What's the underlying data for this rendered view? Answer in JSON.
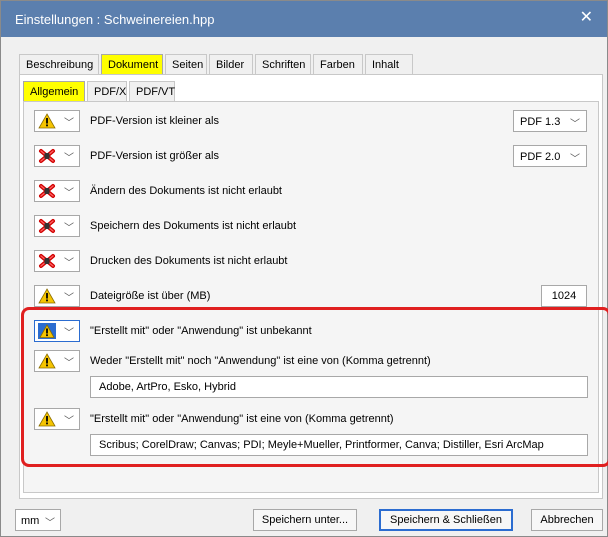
{
  "window": {
    "title": "Einstellungen : Schweinereien.hpp",
    "close_glyph": "✕"
  },
  "tabs": [
    {
      "label": "Beschreibung",
      "active": false
    },
    {
      "label": "Dokument",
      "active": true
    },
    {
      "label": "Seiten",
      "active": false
    },
    {
      "label": "Bilder",
      "active": false
    },
    {
      "label": "Schriften",
      "active": false
    },
    {
      "label": "Farben",
      "active": false
    },
    {
      "label": "Inhalt",
      "active": false
    }
  ],
  "subtabs": [
    {
      "label": "Allgemein",
      "active": true
    },
    {
      "label": "PDF/X",
      "active": false
    },
    {
      "label": "PDF/VT",
      "active": false
    }
  ],
  "rules": {
    "r1": {
      "severity": "warning-icon",
      "label": "PDF-Version ist kleiner als",
      "select": "PDF 1.3"
    },
    "r2": {
      "severity": "error-icon",
      "label": "PDF-Version ist größer als",
      "select": "PDF 2.0"
    },
    "r3": {
      "severity": "error-icon",
      "label": "Ändern des Dokuments ist nicht erlaubt"
    },
    "r4": {
      "severity": "error-icon",
      "label": "Speichern des Dokuments ist nicht erlaubt"
    },
    "r5": {
      "severity": "error-icon",
      "label": "Drucken des Dokuments ist nicht erlaubt"
    },
    "r6": {
      "severity": "warning-icon",
      "label": "Dateigröße ist über (MB)",
      "value": "1024"
    },
    "r7": {
      "severity": "warning-icon",
      "label": "\"Erstellt mit\" oder \"Anwendung\" ist unbekannt"
    },
    "r8": {
      "severity": "warning-icon",
      "label": "Weder \"Erstellt mit\" noch \"Anwendung\" ist eine von (Komma getrennt)",
      "value": "Adobe, ArtPro, Esko, Hybrid"
    },
    "r9": {
      "severity": "warning-icon",
      "label": "\"Erstellt mit\" oder \"Anwendung\" ist eine von (Komma getrennt)",
      "value": "Scribus; CorelDraw; Canvas; PDI; Meyle+Mueller, Printformer, Canva; Distiller, Esri ArcMap"
    }
  },
  "bottom": {
    "unit": "mm",
    "save_as": "Speichern unter...",
    "save_close": "Speichern & Schließen",
    "cancel": "Abbrechen"
  },
  "colors": {
    "titlebar": "#5b7fae",
    "highlight": "#ffff00",
    "annotation": "#e02020",
    "warning": "#f5c400",
    "error": "#d00000"
  }
}
